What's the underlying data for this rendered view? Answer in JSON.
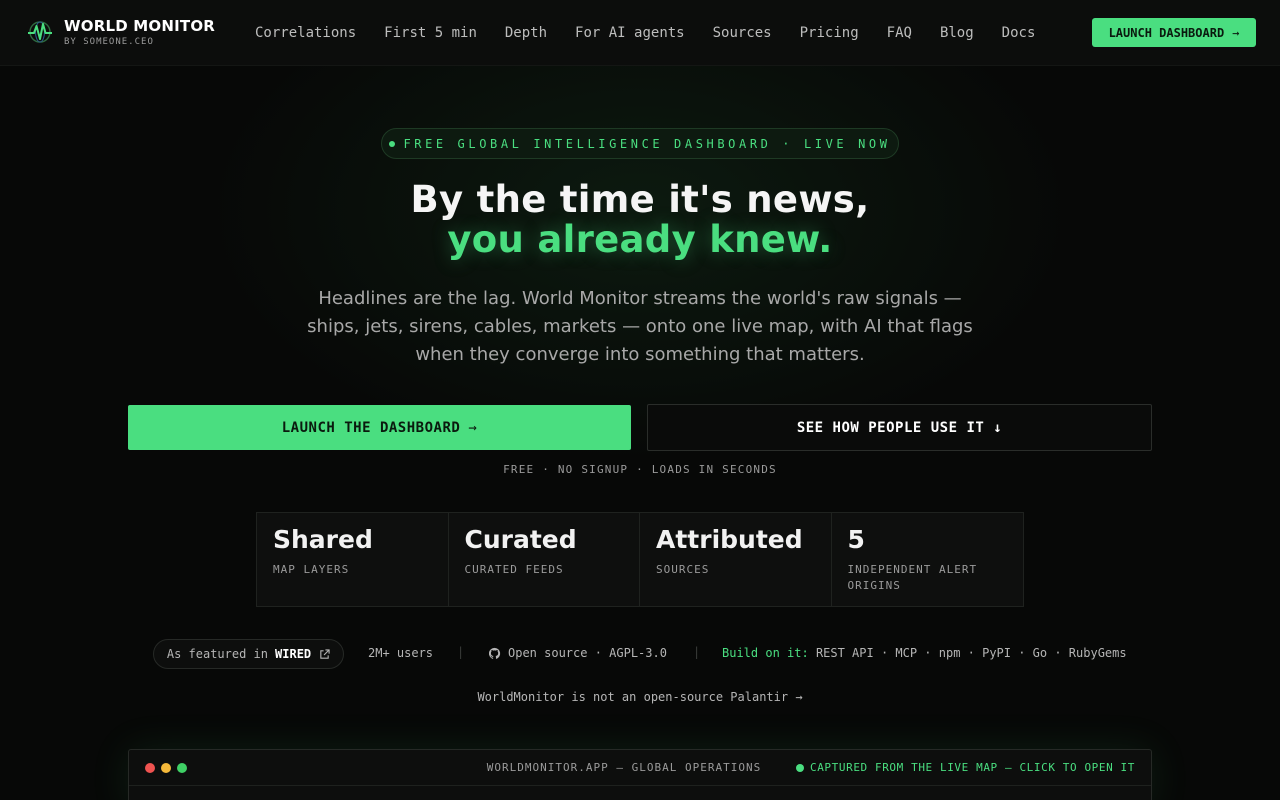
{
  "brand": {
    "title": "WORLD MONITOR",
    "subtitle": "BY SOMEONE.CEO",
    "logo_icon": "pulse-globe-icon"
  },
  "nav": {
    "links": [
      "Correlations",
      "First 5 min",
      "Depth",
      "For AI agents",
      "Sources",
      "Pricing",
      "FAQ",
      "Blog",
      "Docs"
    ],
    "cta_label": "LAUNCH DASHBOARD",
    "cta_arrow": "→"
  },
  "hero": {
    "pill": "FREE GLOBAL INTELLIGENCE DASHBOARD · LIVE NOW",
    "headline_line1": "By the time it's news,",
    "headline_line2": "you already knew.",
    "lead": "Headlines are the lag. World Monitor streams the world's raw signals — ships, jets, sirens, cables, markets — onto one live map, with AI that flags when they converge into something that matters.",
    "primary_cta": "LAUNCH THE DASHBOARD",
    "primary_arrow": "→",
    "secondary_cta": "SEE HOW PEOPLE USE IT ↓",
    "fineprint": "FREE · NO SIGNUP · LOADS IN SECONDS"
  },
  "stats": [
    {
      "value": "Shared",
      "label": "MAP LAYERS"
    },
    {
      "value": "Curated",
      "label": "CURATED FEEDS"
    },
    {
      "value": "Attributed",
      "label": "SOURCES"
    },
    {
      "value": "5",
      "label": "INDEPENDENT ALERT ORIGINS"
    }
  ],
  "badges": {
    "featured_prefix": "As featured in",
    "featured_name": "WIRED",
    "users": "2M+ users",
    "open_source": "Open source · AGPL-3.0",
    "build_label": "Build on it:",
    "build_items": "REST API · MCP · npm · PyPI · Go · RubyGems",
    "separator": "|"
  },
  "palantir_link": "WorldMonitor is not an open-source Palantir →",
  "preview": {
    "title": "WORLDMONITOR.APP — GLOBAL OPERATIONS",
    "caption": "CAPTURED FROM THE LIVE MAP — CLICK TO OPEN IT"
  },
  "colors": {
    "accent": "#4ade80",
    "background": "#070807",
    "traffic_red": "#ef5350",
    "traffic_yellow": "#f5b93a",
    "traffic_green": "#3fd065"
  }
}
